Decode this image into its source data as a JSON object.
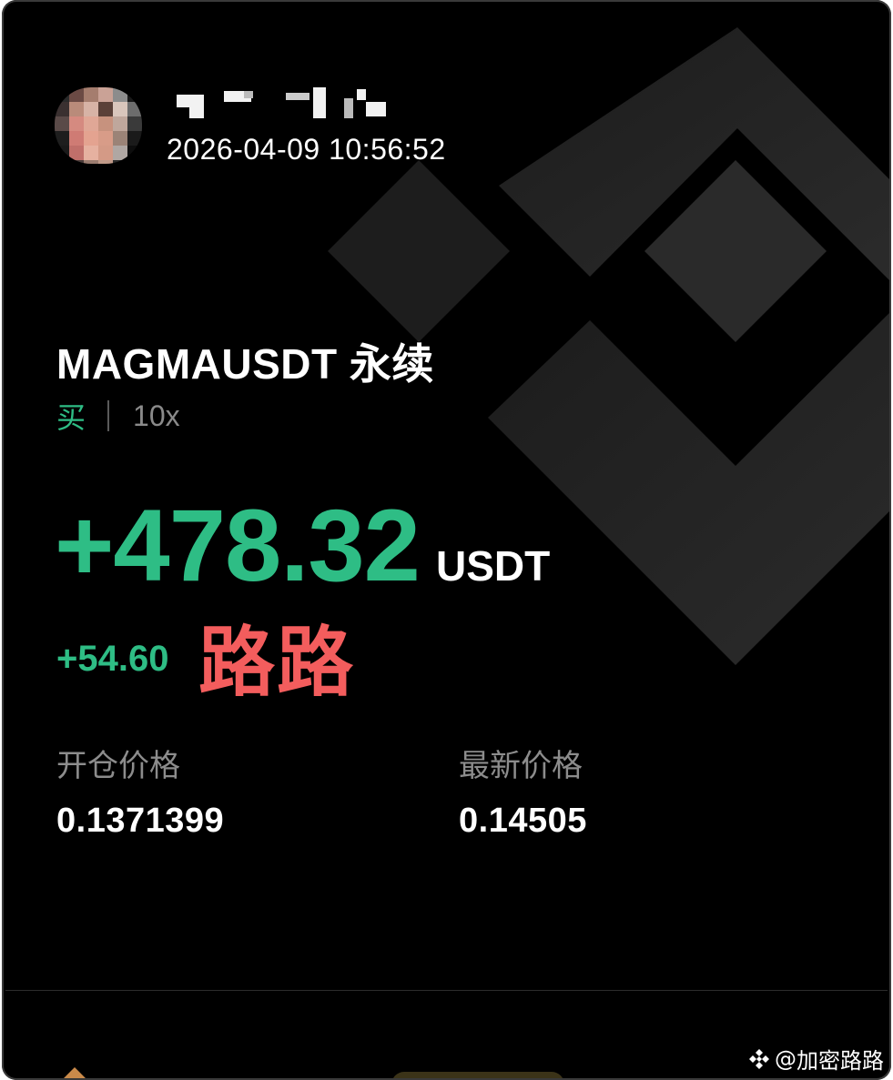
{
  "header": {
    "timestamp": "2026-04-09 10:56:52"
  },
  "position": {
    "symbol": "MAGMAUSDT 永续",
    "side": "买",
    "leverage": "10x",
    "pnl": "+478.32",
    "pnl_unit": "USDT",
    "roi": "+54.60",
    "overlay_mark": "路路"
  },
  "stats": {
    "entry_label": "开仓价格",
    "entry_value": "0.1371399",
    "last_label": "最新价格",
    "last_value": "0.14505"
  },
  "credit": {
    "symbol": "@",
    "name": "加密路路"
  },
  "colors": {
    "background": "#000000",
    "profit_green": "#2ebd85",
    "overlay_red": "#f35d5d",
    "label_gray": "#8c8c8c"
  },
  "icons": {
    "watermark": "binance-logo-icon",
    "credit": "binance-diamond-icon"
  }
}
